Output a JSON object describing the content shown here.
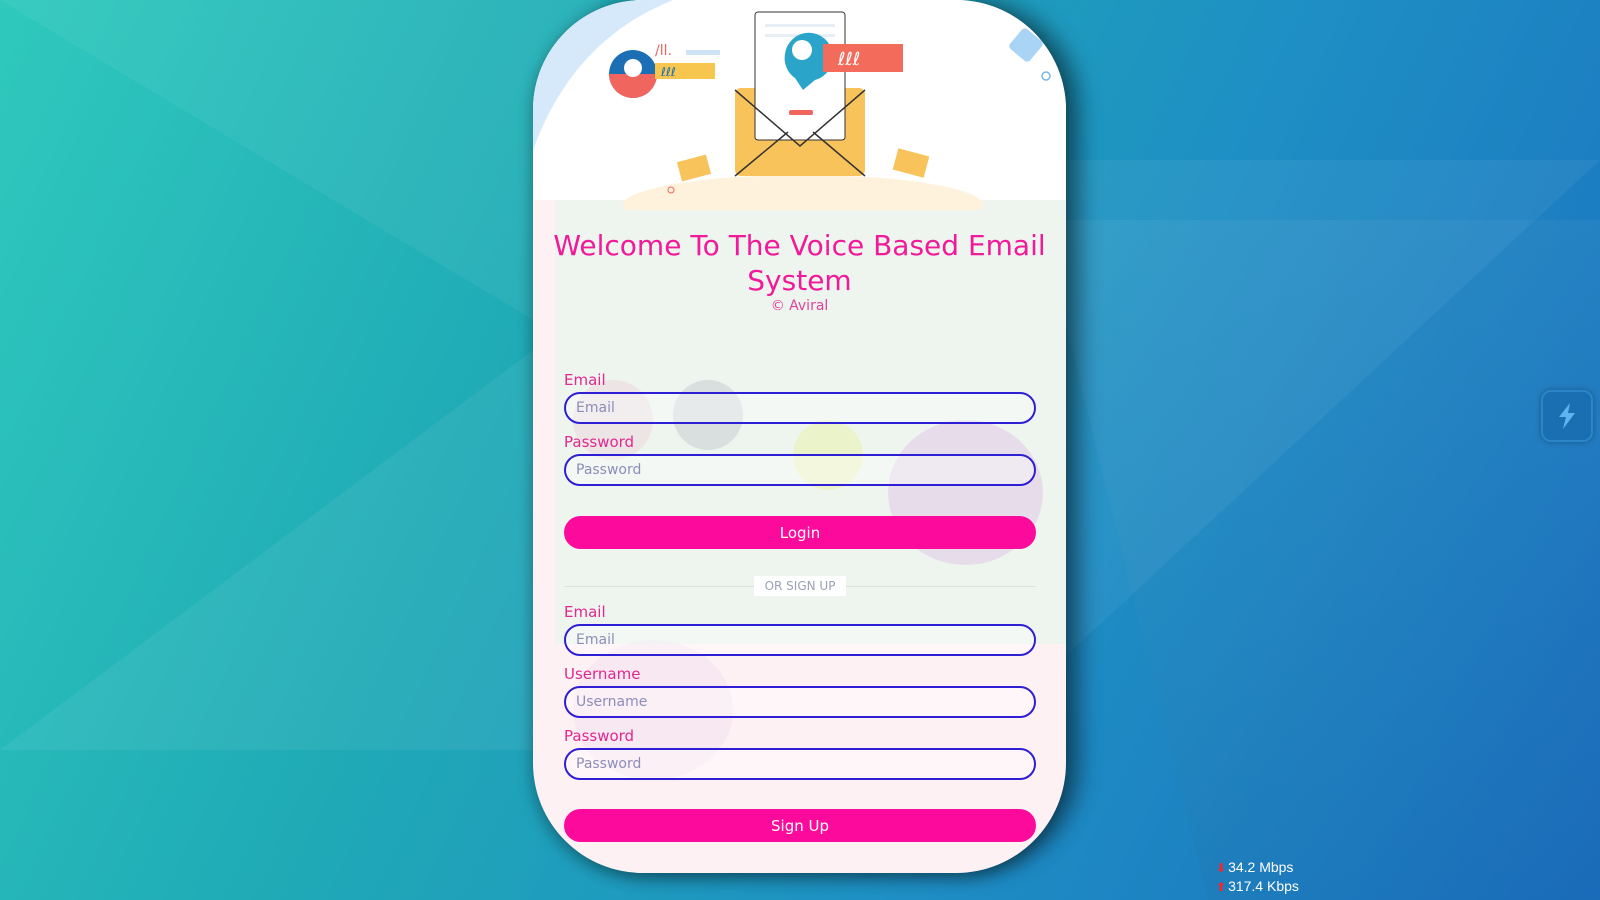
{
  "app": {
    "title": "Welcome To The Voice Based Email System",
    "copyright": "© Aviral"
  },
  "login": {
    "email_label": "Email",
    "email_placeholder": "Email",
    "password_label": "Password",
    "password_placeholder": "Password",
    "button_label": "Login"
  },
  "divider": {
    "text": "OR SIGN UP"
  },
  "signup": {
    "email_label": "Email",
    "email_placeholder": "Email",
    "username_label": "Username",
    "username_placeholder": "Username",
    "password_label": "Password",
    "password_placeholder": "Password",
    "button_label": "Sign Up"
  },
  "network": {
    "download": "34.2 Mbps",
    "upload": "317.4 Kbps"
  },
  "colors": {
    "accent": "#fb0a9c",
    "title": "#f01a9a",
    "input_border": "#2e1fd6"
  },
  "icons": {
    "hero": "email-envelope-illustration",
    "side_widget": "lightning-widget-icon"
  }
}
